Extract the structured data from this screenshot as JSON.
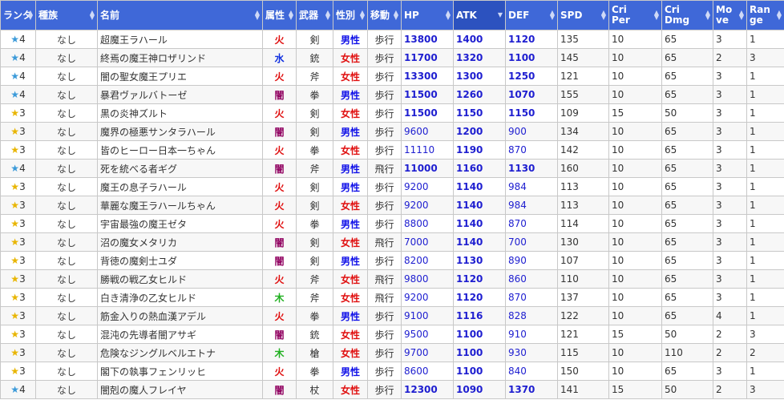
{
  "headers": [
    {
      "label": "ランタ",
      "sorted": false
    },
    {
      "label": "種族",
      "sorted": false
    },
    {
      "label": "名前",
      "sorted": false
    },
    {
      "label": "属性",
      "sorted": false
    },
    {
      "label": "武器",
      "sorted": false
    },
    {
      "label": "性別",
      "sorted": false
    },
    {
      "label": "移動",
      "sorted": false
    },
    {
      "label": "HP",
      "sorted": false
    },
    {
      "label": "ATK",
      "sorted": true
    },
    {
      "label": "DEF",
      "sorted": false
    },
    {
      "label": "SPD",
      "sorted": false
    },
    {
      "label": "Cri Per",
      "sorted": false
    },
    {
      "label": "Cri Dmg",
      "sorted": false
    },
    {
      "label": "Mo ve",
      "sorted": false
    },
    {
      "label": "Ran ge",
      "sorted": false
    }
  ],
  "rows": [
    {
      "rank": "4",
      "star": "blue",
      "race": "なし",
      "name": "超魔王ラハール",
      "attr": "火",
      "attr_type": "fire",
      "weapon": "剣",
      "gender": "男性",
      "gtype": "male",
      "move": "歩行",
      "hp": "13800",
      "atk": "1400",
      "def": "1120",
      "spd": "135",
      "cri_per": "10",
      "cri_dmg": "65",
      "mov": "3",
      "range": "1",
      "bold_stats": true
    },
    {
      "rank": "4",
      "star": "blue",
      "race": "なし",
      "name": "終焉の魔王神ロザリンド",
      "attr": "水",
      "attr_type": "water",
      "weapon": "銃",
      "gender": "女性",
      "gtype": "female",
      "move": "歩行",
      "hp": "11700",
      "atk": "1320",
      "def": "1100",
      "spd": "145",
      "cri_per": "10",
      "cri_dmg": "65",
      "mov": "2",
      "range": "3",
      "bold_stats": true
    },
    {
      "rank": "4",
      "star": "blue",
      "race": "なし",
      "name": "闇の聖女魔王プリエ",
      "attr": "火",
      "attr_type": "fire",
      "weapon": "斧",
      "gender": "女性",
      "gtype": "female",
      "move": "歩行",
      "hp": "13300",
      "atk": "1300",
      "def": "1250",
      "spd": "121",
      "cri_per": "10",
      "cri_dmg": "65",
      "mov": "3",
      "range": "1",
      "bold_stats": true
    },
    {
      "rank": "4",
      "star": "blue",
      "race": "なし",
      "name": "暴君ヴァルバトーゼ",
      "attr": "闇",
      "attr_type": "dark",
      "weapon": "拳",
      "gender": "男性",
      "gtype": "male",
      "move": "歩行",
      "hp": "11500",
      "atk": "1260",
      "def": "1070",
      "spd": "155",
      "cri_per": "10",
      "cri_dmg": "65",
      "mov": "3",
      "range": "1",
      "bold_stats": true
    },
    {
      "rank": "3",
      "star": "gold",
      "race": "なし",
      "name": "黒の炎神ズルト",
      "attr": "火",
      "attr_type": "fire",
      "weapon": "剣",
      "gender": "女性",
      "gtype": "female",
      "move": "歩行",
      "hp": "11500",
      "atk": "1150",
      "def": "1150",
      "spd": "109",
      "cri_per": "15",
      "cri_dmg": "50",
      "mov": "3",
      "range": "1",
      "bold_stats": true
    },
    {
      "rank": "3",
      "star": "gold",
      "race": "なし",
      "name": "魔界の極悪サンタラハール",
      "attr": "闇",
      "attr_type": "dark",
      "weapon": "剣",
      "gender": "男性",
      "gtype": "male",
      "move": "歩行",
      "hp": "9600",
      "atk": "1200",
      "def": "900",
      "spd": "134",
      "cri_per": "10",
      "cri_dmg": "65",
      "mov": "3",
      "range": "1",
      "bold_stats": false
    },
    {
      "rank": "3",
      "star": "gold",
      "race": "なし",
      "name": "皆のヒーロー日本一ちゃん",
      "attr": "火",
      "attr_type": "fire",
      "weapon": "拳",
      "gender": "女性",
      "gtype": "female",
      "move": "歩行",
      "hp": "11110",
      "atk": "1190",
      "def": "870",
      "spd": "142",
      "cri_per": "10",
      "cri_dmg": "65",
      "mov": "3",
      "range": "1",
      "bold_stats": false
    },
    {
      "rank": "4",
      "star": "blue",
      "race": "なし",
      "name": "死を統べる者ギグ",
      "attr": "闇",
      "attr_type": "dark",
      "weapon": "斧",
      "gender": "男性",
      "gtype": "male",
      "move": "飛行",
      "hp": "11000",
      "atk": "1160",
      "def": "1130",
      "spd": "160",
      "cri_per": "10",
      "cri_dmg": "65",
      "mov": "3",
      "range": "1",
      "bold_stats": true
    },
    {
      "rank": "3",
      "star": "gold",
      "race": "なし",
      "name": "魔王の息子ラハール",
      "attr": "火",
      "attr_type": "fire",
      "weapon": "剣",
      "gender": "男性",
      "gtype": "male",
      "move": "歩行",
      "hp": "9200",
      "atk": "1140",
      "def": "984",
      "spd": "113",
      "cri_per": "10",
      "cri_dmg": "65",
      "mov": "3",
      "range": "1",
      "bold_stats": false
    },
    {
      "rank": "3",
      "star": "gold",
      "race": "なし",
      "name": "華麗な魔王ラハールちゃん",
      "attr": "火",
      "attr_type": "fire",
      "weapon": "剣",
      "gender": "女性",
      "gtype": "female",
      "move": "歩行",
      "hp": "9200",
      "atk": "1140",
      "def": "984",
      "spd": "113",
      "cri_per": "10",
      "cri_dmg": "65",
      "mov": "3",
      "range": "1",
      "bold_stats": false
    },
    {
      "rank": "3",
      "star": "gold",
      "race": "なし",
      "name": "宇宙最強の魔王ゼタ",
      "attr": "火",
      "attr_type": "fire",
      "weapon": "拳",
      "gender": "男性",
      "gtype": "male",
      "move": "歩行",
      "hp": "8800",
      "atk": "1140",
      "def": "870",
      "spd": "114",
      "cri_per": "10",
      "cri_dmg": "65",
      "mov": "3",
      "range": "1",
      "bold_stats": false
    },
    {
      "rank": "3",
      "star": "gold",
      "race": "なし",
      "name": "沼の魔女メタリカ",
      "attr": "闇",
      "attr_type": "dark",
      "weapon": "剣",
      "gender": "女性",
      "gtype": "female",
      "move": "飛行",
      "hp": "7000",
      "atk": "1140",
      "def": "700",
      "spd": "130",
      "cri_per": "10",
      "cri_dmg": "65",
      "mov": "3",
      "range": "1",
      "bold_stats": false
    },
    {
      "rank": "3",
      "star": "gold",
      "race": "なし",
      "name": "背徳の魔剣士ユダ",
      "attr": "闇",
      "attr_type": "dark",
      "weapon": "剣",
      "gender": "男性",
      "gtype": "male",
      "move": "歩行",
      "hp": "8200",
      "atk": "1130",
      "def": "890",
      "spd": "107",
      "cri_per": "10",
      "cri_dmg": "65",
      "mov": "3",
      "range": "1",
      "bold_stats": false
    },
    {
      "rank": "3",
      "star": "gold",
      "race": "なし",
      "name": "勝戦の戦乙女ヒルド",
      "attr": "火",
      "attr_type": "fire",
      "weapon": "斧",
      "gender": "女性",
      "gtype": "female",
      "move": "飛行",
      "hp": "9800",
      "atk": "1120",
      "def": "860",
      "spd": "110",
      "cri_per": "10",
      "cri_dmg": "65",
      "mov": "3",
      "range": "1",
      "bold_stats": false
    },
    {
      "rank": "3",
      "star": "gold",
      "race": "なし",
      "name": "白き清浄の乙女ヒルド",
      "attr": "木",
      "attr_type": "wood",
      "weapon": "斧",
      "gender": "女性",
      "gtype": "female",
      "move": "飛行",
      "hp": "9200",
      "atk": "1120",
      "def": "870",
      "spd": "137",
      "cri_per": "10",
      "cri_dmg": "65",
      "mov": "3",
      "range": "1",
      "bold_stats": false
    },
    {
      "rank": "3",
      "star": "gold",
      "race": "なし",
      "name": "筋金入りの熱血漢アデル",
      "attr": "火",
      "attr_type": "fire",
      "weapon": "拳",
      "gender": "男性",
      "gtype": "male",
      "move": "歩行",
      "hp": "9100",
      "atk": "1116",
      "def": "828",
      "spd": "122",
      "cri_per": "10",
      "cri_dmg": "65",
      "mov": "4",
      "range": "1",
      "bold_stats": false
    },
    {
      "rank": "3",
      "star": "gold",
      "race": "なし",
      "name": "混沌の先導者闇アサギ",
      "attr": "闇",
      "attr_type": "dark",
      "weapon": "銃",
      "gender": "女性",
      "gtype": "female",
      "move": "歩行",
      "hp": "9500",
      "atk": "1100",
      "def": "910",
      "spd": "121",
      "cri_per": "15",
      "cri_dmg": "50",
      "mov": "2",
      "range": "3",
      "bold_stats": false
    },
    {
      "rank": "3",
      "star": "gold",
      "race": "なし",
      "name": "危険なジングルベルエトナ",
      "attr": "木",
      "attr_type": "wood",
      "weapon": "槍",
      "gender": "女性",
      "gtype": "female",
      "move": "歩行",
      "hp": "9700",
      "atk": "1100",
      "def": "930",
      "spd": "115",
      "cri_per": "10",
      "cri_dmg": "110",
      "mov": "2",
      "range": "2",
      "bold_stats": false
    },
    {
      "rank": "3",
      "star": "gold",
      "race": "なし",
      "name": "閣下の執事フェンリッヒ",
      "attr": "火",
      "attr_type": "fire",
      "weapon": "拳",
      "gender": "男性",
      "gtype": "male",
      "move": "歩行",
      "hp": "8600",
      "atk": "1100",
      "def": "840",
      "spd": "150",
      "cri_per": "10",
      "cri_dmg": "65",
      "mov": "3",
      "range": "1",
      "bold_stats": false
    },
    {
      "rank": "4",
      "star": "blue",
      "race": "なし",
      "name": "闇剋の魔人フレイヤ",
      "attr": "闇",
      "attr_type": "dark",
      "weapon": "杖",
      "gender": "女性",
      "gtype": "female",
      "move": "歩行",
      "hp": "12300",
      "atk": "1090",
      "def": "1370",
      "spd": "141",
      "cri_per": "15",
      "cri_dmg": "50",
      "mov": "2",
      "range": "3",
      "bold_stats": true
    }
  ]
}
